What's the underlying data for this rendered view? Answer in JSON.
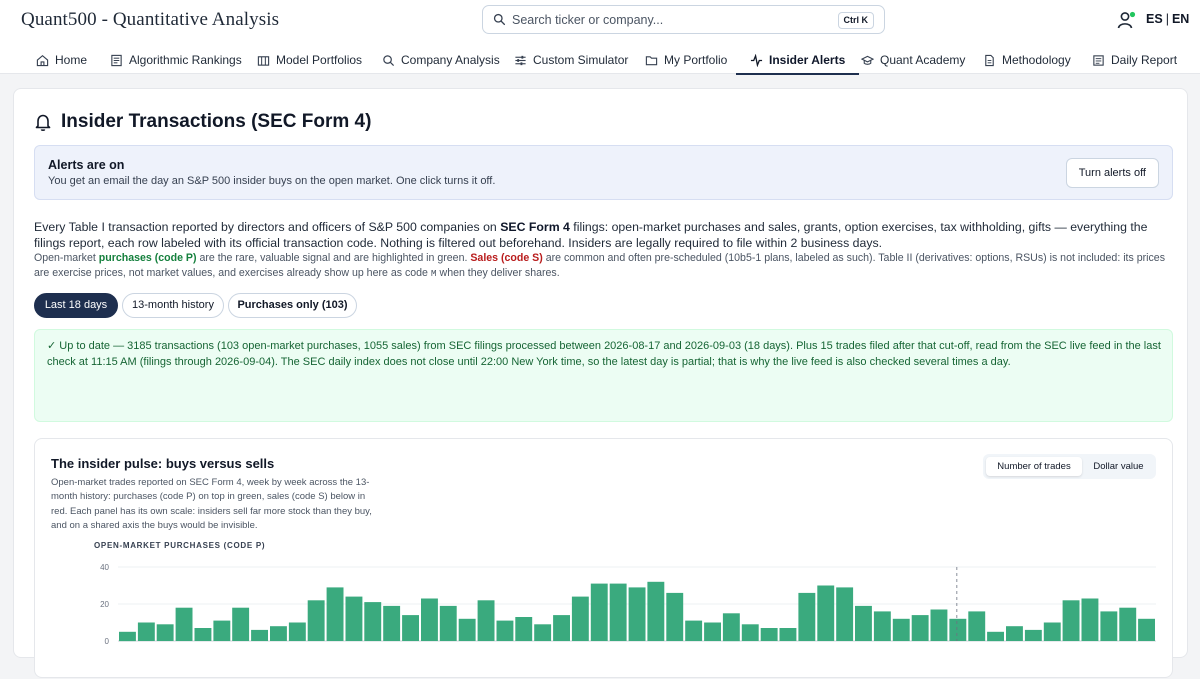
{
  "app": {
    "title": "Quant500 - Quantitative Analysis",
    "search": {
      "placeholder": "Search ticker or company...",
      "shortcut": "Ctrl K"
    },
    "lang": {
      "es": "ES",
      "sep": "|",
      "en": "EN"
    }
  },
  "nav": [
    {
      "label": "Home",
      "icon": "home-icon"
    },
    {
      "label": "Algorithmic Rankings",
      "icon": "ranking-icon"
    },
    {
      "label": "Model Portfolios",
      "icon": "portfolio-icon"
    },
    {
      "label": "Company Analysis",
      "icon": "search-icon"
    },
    {
      "label": "Custom Simulator",
      "icon": "sliders-icon"
    },
    {
      "label": "My Portfolio",
      "icon": "folder-icon"
    },
    {
      "label": "Insider Alerts",
      "icon": "activity-icon",
      "active": true
    },
    {
      "label": "Quant Academy",
      "icon": "graduation-cap-icon"
    },
    {
      "label": "Methodology",
      "icon": "document-icon"
    },
    {
      "label": "Daily Report",
      "icon": "newspaper-icon"
    }
  ],
  "page": {
    "title": "Insider Transactions (SEC Form 4)",
    "alert": {
      "title": "Alerts are on",
      "text": "You get an email the day an S&P 500 insider buys on the open market. One click turns it off.",
      "button": "Turn alerts off"
    },
    "desc1": {
      "part1": "Every Table I transaction reported by directors and officers of S&P 500 companies on ",
      "bold": "SEC Form 4",
      "part2": " filings: open-market purchases and sales, grants, option exercises, tax withholding, gifts — everything the filings report, each row labeled with its official transaction code. Nothing is filtered out beforehand. Insiders are legally required to file within 2 business days."
    },
    "desc2": {
      "part1": "Open-market ",
      "purchases": "purchases (code P)",
      "part2": " are the rare, valuable signal and are highlighted in green. ",
      "sales": "Sales (code S)",
      "part3": " are common and often pre-scheduled (10b5-1 plans, labeled as such). Table II (derivatives: options, RSUs) is not included: its prices are exercise prices, not market values, and exercises already show up here as code ",
      "code": "M",
      "part4": " when they deliver shares."
    },
    "tabs": [
      {
        "label": "Last 18 days",
        "active": true
      },
      {
        "label": "13-month history"
      },
      {
        "label": "Purchases only (103)"
      }
    ],
    "status": "✓ Up to date — 3185 transactions (103 open-market purchases, 1055 sales) from SEC filings processed between 2026-08-17 and 2026-09-03 (18 days). Plus 15 trades filed after that cut-off, read from the SEC live feed in the last check at 11:15 AM (filings through 2026-09-04). The SEC daily index does not close until 22:00 New York time, so the latest day is partial; that is why the live feed is also checked several times a day.",
    "pulse": {
      "title": "The insider pulse: buys versus sells",
      "desc": "Open-market trades reported on SEC Form 4, week by week across the 13-month history: purchases (code P) on top in green, sales (code S) below in red. Each panel has its own scale: insiders sell far more stock than they buy, and on a shared axis the buys would be invisible.",
      "toggle": [
        "Number of trades",
        "Dollar value"
      ],
      "panel_label": "OPEN-MARKET PURCHASES (CODE P)"
    }
  },
  "colors": {
    "navy": "#1e2f4f",
    "green_bar": "#3aaa7e",
    "green_text": "#15803d",
    "red_text": "#b91c1c"
  },
  "chart_data": {
    "type": "bar",
    "title": "OPEN-MARKET PURCHASES (CODE P)",
    "ylim": [
      0,
      40
    ],
    "yticks": [
      0,
      20,
      40
    ],
    "grid": true,
    "marker_index": 44,
    "series": [
      {
        "name": "OPEN-MARKET PURCHASES (CODE P)",
        "values": [
          5,
          10,
          9,
          18,
          7,
          11,
          18,
          6,
          8,
          10,
          22,
          29,
          24,
          21,
          19,
          14,
          23,
          19,
          12,
          22,
          11,
          13,
          9,
          14,
          24,
          31,
          31,
          29,
          32,
          26,
          11,
          10,
          15,
          9,
          7,
          7,
          26,
          30,
          29,
          19,
          16,
          12,
          14,
          17,
          12,
          16,
          5,
          8,
          6,
          10,
          22,
          23,
          16,
          18,
          12
        ]
      }
    ]
  }
}
